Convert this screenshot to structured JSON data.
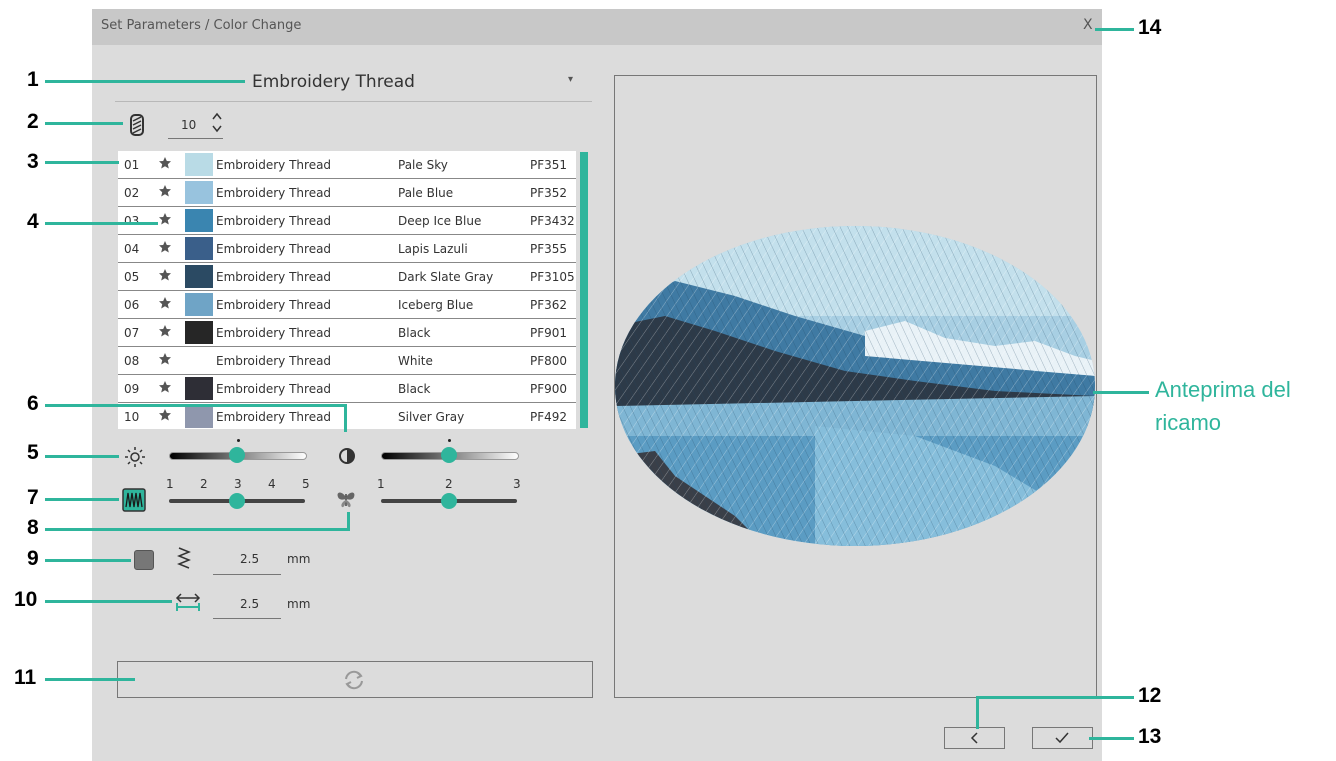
{
  "dialog": {
    "title": "Set Parameters / Color Change",
    "close_label": "X"
  },
  "thread_dropdown": {
    "selected": "Embroidery Thread"
  },
  "color_count": {
    "value": "10"
  },
  "threads": [
    {
      "no": "01",
      "brand": "Embroidery Thread",
      "name": "Pale Sky",
      "code": "PF351",
      "color": "#b9dbe6"
    },
    {
      "no": "02",
      "brand": "Embroidery Thread",
      "name": "Pale Blue",
      "code": "PF352",
      "color": "#98c3de"
    },
    {
      "no": "03",
      "brand": "Embroidery Thread",
      "name": "Deep Ice Blue",
      "code": "PF3432",
      "color": "#3a85b0"
    },
    {
      "no": "04",
      "brand": "Embroidery Thread",
      "name": "Lapis Lazuli",
      "code": "PF355",
      "color": "#3a5f8a"
    },
    {
      "no": "05",
      "brand": "Embroidery Thread",
      "name": "Dark Slate Gray",
      "code": "PF3105",
      "color": "#2b4a63"
    },
    {
      "no": "06",
      "brand": "Embroidery Thread",
      "name": "Iceberg Blue",
      "code": "PF362",
      "color": "#6fa4c6"
    },
    {
      "no": "07",
      "brand": "Embroidery Thread",
      "name": "Black",
      "code": "PF901",
      "color": "#262626"
    },
    {
      "no": "08",
      "brand": "Embroidery Thread",
      "name": "White",
      "code": "PF800",
      "color": "#ffffff"
    },
    {
      "no": "09",
      "brand": "Embroidery Thread",
      "name": "Black",
      "code": "PF900",
      "color": "#2e2e36"
    },
    {
      "no": "10",
      "brand": "Embroidery Thread",
      "name": "Silver Gray",
      "code": "PF492",
      "color": "#8f97ad"
    }
  ],
  "sliders": {
    "brightness": {
      "level": 0.5
    },
    "contrast": {
      "level": 0.5
    },
    "density": {
      "ticks": [
        "1",
        "2",
        "3",
        "4",
        "5"
      ],
      "value": 3
    },
    "detail": {
      "ticks": [
        "1",
        "2",
        "3"
      ],
      "value": 2
    }
  },
  "fields": {
    "underlay_value": "2.5",
    "underlay_unit": "mm",
    "width_value": "2.5",
    "width_unit": "mm"
  },
  "callouts": [
    "1",
    "2",
    "3",
    "4",
    "5",
    "6",
    "7",
    "8",
    "9",
    "10",
    "11",
    "12",
    "13",
    "14"
  ],
  "preview": {
    "label_line1": "Anteprima del",
    "label_line2": "ricamo"
  },
  "colors": {
    "accent": "#2fb59c",
    "dialog_bg": "#dcdcdc",
    "titlebar": "#c8c8c8"
  }
}
